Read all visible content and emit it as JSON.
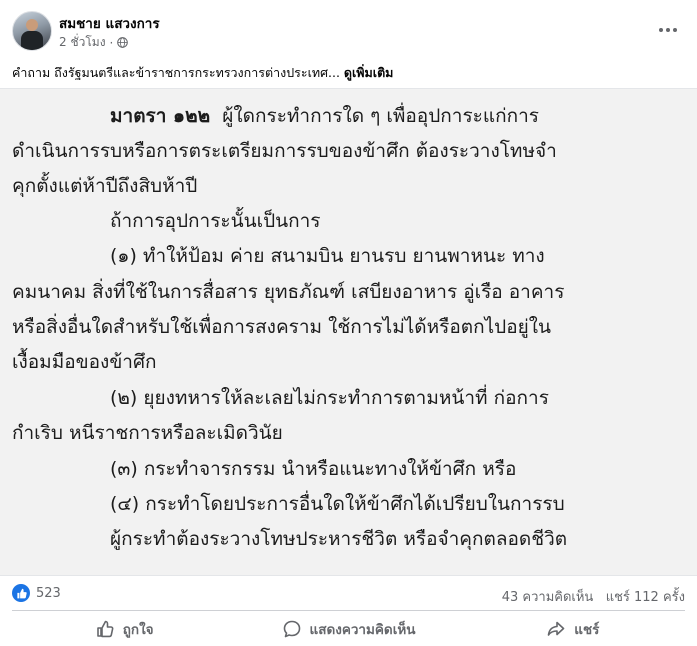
{
  "post": {
    "author": "สมชาย แสวงการ",
    "time": "2 ชั่วโมง",
    "separator": "·",
    "caption": "คำถาม ถึงรัฐมนตรีและข้าราชการกระทรวงการต่างประเทศ...",
    "see_more": "ดูเพิ่มเติม"
  },
  "law_text": {
    "line1_bold": "มาตรา ๑๒๒",
    "line1_rest": "ผู้ใดกระทำการใด ๆ เพื่ออุปการะแก่การ",
    "line2": "ดำเนินการรบหรือการตระเตรียมการรบของข้าศึก ต้องระวางโทษจำ",
    "line3": "คุกตั้งแต่ห้าปีถึงสิบห้าปี",
    "line4": "ถ้าการอุปการะนั้นเป็นการ",
    "line5": "(๑) ทำให้ป้อม ค่าย สนามบิน ยานรบ ยานพาหนะ ทาง",
    "line6": "คมนาคม สิ่งที่ใช้ในการสื่อสาร ยุทธภัณฑ์ เสบียงอาหาร อู่เรือ อาคาร",
    "line7": "หรือสิ่งอื่นใดสำหรับใช้เพื่อการสงคราม ใช้การไม่ได้หรือตกไปอยู่ใน",
    "line8": "เงื้อมมือของข้าศึก",
    "line9": "(๒) ยุยงทหารให้ละเลยไม่กระทำการตามหน้าที่ ก่อการ",
    "line10": "กำเริบ หนีราชการหรือละเมิดวินัย",
    "line11": "(๓) กระทำจารกรรม นำหรือแนะทางให้ข้าศึก หรือ",
    "line12": "(๔) กระทำโดยประการอื่นใดให้ข้าศึกได้เปรียบในการรบ",
    "line13": "ผู้กระทำต้องระวางโทษประหารชีวิต หรือจำคุกตลอดชีวิต"
  },
  "stats": {
    "likes": "523",
    "comments": "43 ความคิดเห็น",
    "shares": "แชร์ 112 ครั้ง"
  },
  "actions": {
    "like": "ถูกใจ",
    "comment": "แสดงความคิดเห็น",
    "share": "แชร์"
  },
  "colors": {
    "like_blue": "#1b74e4",
    "secondary_text": "#65676b",
    "image_background": "#f2f2f2"
  },
  "icons": [
    "globe-icon",
    "more-icon",
    "like-badge-icon",
    "like-icon",
    "comment-icon",
    "share-icon"
  ]
}
